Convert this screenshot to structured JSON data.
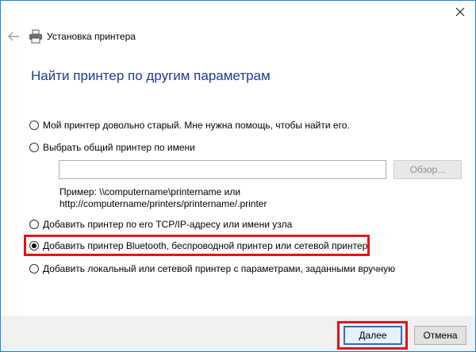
{
  "window": {
    "header_title": "Установка принтера",
    "icons": {
      "close": "close-icon",
      "back": "back-arrow-icon",
      "printer": "printer-icon"
    }
  },
  "page": {
    "title": "Найти принтер по другим параметрам"
  },
  "options": [
    {
      "label": "Мой принтер довольно старый. Мне нужна помощь, чтобы найти его.",
      "checked": false
    },
    {
      "label": "Выбрать общий принтер по имени",
      "checked": false
    },
    {
      "label": "Добавить принтер по его TCP/IP-адресу или имени узла",
      "checked": false
    },
    {
      "label": "Добавить принтер Bluetooth, беспроводной принтер или сетевой принтер",
      "checked": true
    },
    {
      "label": "Добавить локальный или сетевой принтер с параметрами, заданными вручную",
      "checked": false
    }
  ],
  "share_name": {
    "value": "",
    "browse_label": "Обзор...",
    "example_line1": "Пример: \\\\computername\\printername или",
    "example_line2": "http://computername/printers/printername/.printer"
  },
  "footer": {
    "next_label": "Далее",
    "cancel_label": "Отмена"
  },
  "colors": {
    "title": "#1c3d8c",
    "highlight": "#e1141c",
    "window_border": "#1883d7",
    "footer_bg": "#f0f0f0"
  }
}
